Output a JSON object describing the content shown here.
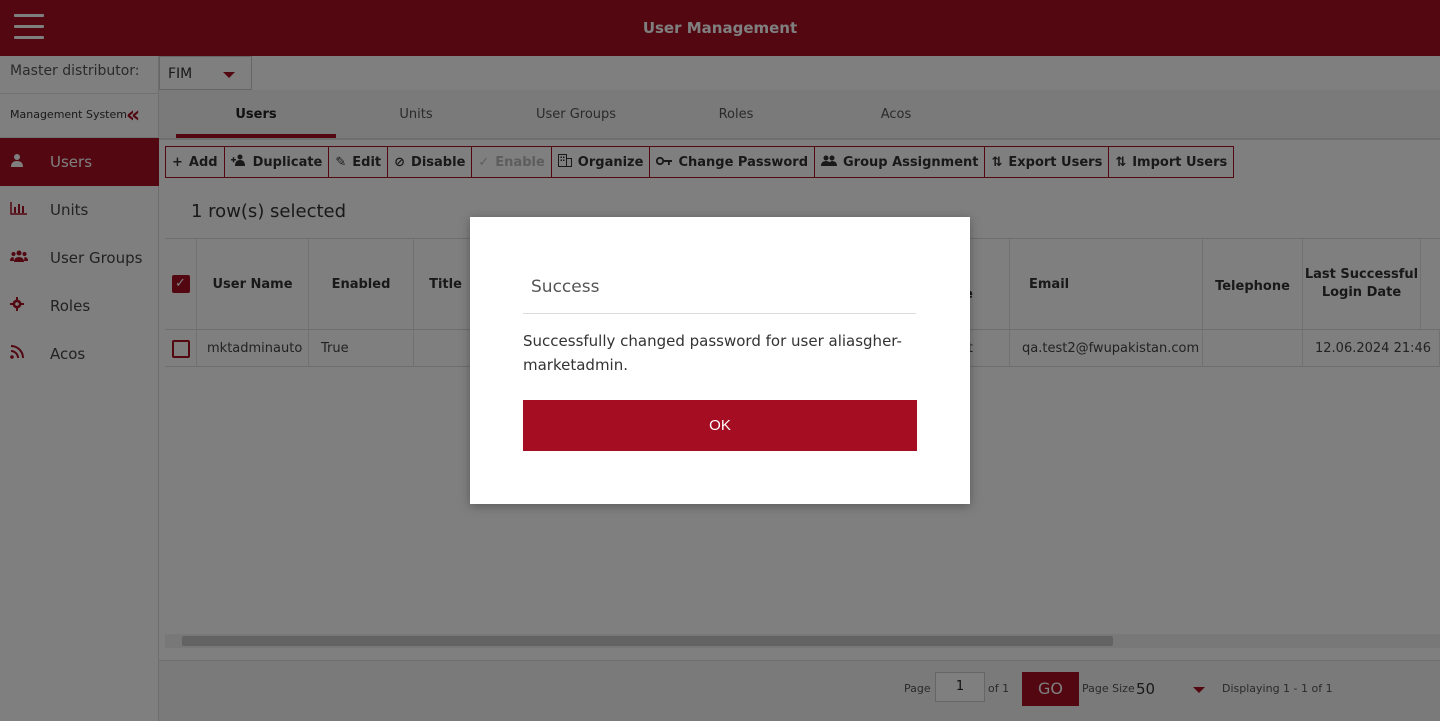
{
  "app": {
    "title": "User Management"
  },
  "sidebar": {
    "master_distributor_label": "Master distributor:",
    "management_system_label": "Management System",
    "items": [
      {
        "label": "Users",
        "icon": "user-icon",
        "active": true
      },
      {
        "label": "Units",
        "icon": "bar-chart-icon",
        "active": false
      },
      {
        "label": "User Groups",
        "icon": "users-icon",
        "active": false
      },
      {
        "label": "Roles",
        "icon": "gear-icon",
        "active": false
      },
      {
        "label": "Acos",
        "icon": "rss-icon",
        "active": false
      }
    ]
  },
  "distributor": {
    "value": "FIM"
  },
  "tabs": [
    {
      "label": "Users",
      "active": true
    },
    {
      "label": "Units",
      "active": false
    },
    {
      "label": "User Groups",
      "active": false
    },
    {
      "label": "Roles",
      "active": false
    },
    {
      "label": "Acos",
      "active": false
    }
  ],
  "toolbar": {
    "add": "Add",
    "duplicate": "Duplicate",
    "edit": "Edit",
    "disable": "Disable",
    "enable": "Enable",
    "organize": "Organize",
    "change_password": "Change Password",
    "group_assignment": "Group Assignment",
    "export_users": "Export Users",
    "import_users": "Import Users"
  },
  "grid": {
    "rows_selected": "1 row(s) selected",
    "headers": {
      "user_name": "User Name",
      "enabled": "Enabled",
      "title": "Title",
      "partial": "e",
      "email": "Email",
      "telephone": "Telephone",
      "last_login": "Last Successful Login Date"
    },
    "rows": [
      {
        "user_name": "mktadminauto",
        "enabled": "True",
        "partial": "t",
        "email": "qa.test2@fwupakistan.com",
        "last_login": "12.06.2024 21:46"
      }
    ]
  },
  "pager": {
    "page_label": "Page",
    "page_value": "1",
    "of_label": "of 1",
    "go_label": "GO",
    "page_size_label": "Page Size",
    "page_size_value": "50",
    "displaying": "Displaying 1 - 1 of 1"
  },
  "modal": {
    "title": "Success",
    "message": "Successfully changed password for user aliasgher-marketadmin.",
    "ok_label": "OK"
  },
  "colors": {
    "brand": "#a50e22"
  }
}
